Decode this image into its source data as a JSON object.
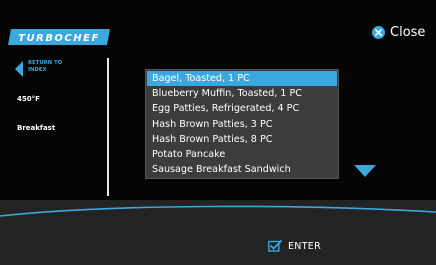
{
  "brand": {
    "logo_text": "TURBOCHEF"
  },
  "header": {
    "close_label": "Close"
  },
  "sidebar": {
    "back_label": "RETURN TO INDEX",
    "temperature": "450°F",
    "category": "Breakfast"
  },
  "menu": {
    "items": [
      {
        "label": "Bagel, Toasted, 1 PC",
        "selected": true
      },
      {
        "label": "Blueberry Muffin, Toasted, 1 PC",
        "selected": false
      },
      {
        "label": "Egg Patties, Refrigerated, 4 PC",
        "selected": false
      },
      {
        "label": "Hash Brown Patties, 3 PC",
        "selected": false
      },
      {
        "label": "Hash Brown Patties, 8 PC",
        "selected": false
      },
      {
        "label": "Potato Pancake",
        "selected": false
      },
      {
        "label": "Sausage Breakfast Sandwich",
        "selected": false
      }
    ]
  },
  "footer": {
    "enter_label": "ENTER"
  },
  "colors": {
    "accent": "#3aa8de",
    "background": "#050505",
    "list_bg": "#3c3c3c",
    "bottom_band": "#232323"
  }
}
